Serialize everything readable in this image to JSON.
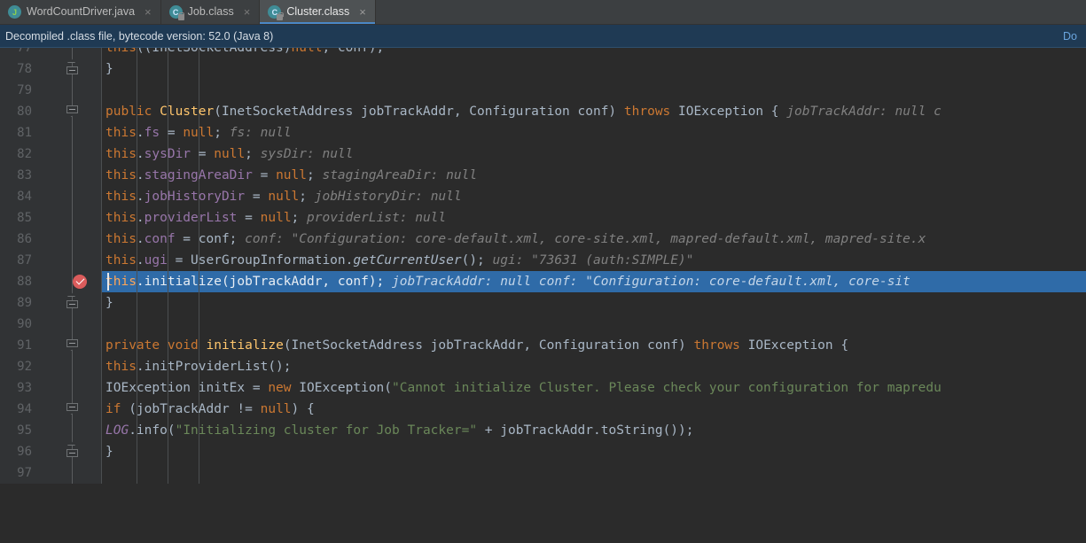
{
  "window": {
    "editor_bg": "#2b2b2b",
    "gutter_bg": "#313335",
    "tabbar_bg": "#3c3f41",
    "accent": "#4a88c7",
    "current_line_bg": "#2f6ba8",
    "breakpoint_color": "#db5c5c"
  },
  "tabs": [
    {
      "label": "WordCountDriver.java",
      "icon": "java-file-icon",
      "close": "×",
      "active": false,
      "locked": false
    },
    {
      "label": "Job.class",
      "icon": "class-file-icon",
      "close": "×",
      "active": false,
      "locked": true
    },
    {
      "label": "Cluster.class",
      "icon": "class-file-icon",
      "close": "×",
      "active": true,
      "locked": true
    }
  ],
  "notification": {
    "message": "Decompiled .class file, bytecode version: 52.0 (Java 8)",
    "action_label": "Do"
  },
  "editor": {
    "language": "Java",
    "current_line": 88,
    "breakpoint_line": 88,
    "lines": [
      {
        "number": "77",
        "clipped": true,
        "fold": null,
        "tokens": [
          {
            "t": "        ",
            "c": "plain"
          },
          {
            "t": "this",
            "c": "kw"
          },
          {
            "t": "((InetSocketAddress)",
            "c": "plain"
          },
          {
            "t": "null",
            "c": "kw"
          },
          {
            "t": ", conf);",
            "c": "plain"
          }
        ]
      },
      {
        "number": "78",
        "fold": "end",
        "tokens": [
          {
            "t": "    }",
            "c": "plain"
          }
        ]
      },
      {
        "number": "79",
        "fold": null,
        "tokens": []
      },
      {
        "number": "80",
        "fold": "start",
        "tokens": [
          {
            "t": "    ",
            "c": "plain"
          },
          {
            "t": "public ",
            "c": "kw"
          },
          {
            "t": "Cluster",
            "c": "cls"
          },
          {
            "t": "(InetSocketAddress jobTrackAddr, Configuration conf) ",
            "c": "plain"
          },
          {
            "t": "throws ",
            "c": "kw"
          },
          {
            "t": "IOException {",
            "c": "plain"
          },
          {
            "t": "   jobTrackAddr: null     c",
            "c": "hint"
          }
        ]
      },
      {
        "number": "81",
        "fold": null,
        "tokens": [
          {
            "t": "        ",
            "c": "plain"
          },
          {
            "t": "this",
            "c": "kw"
          },
          {
            "t": ".",
            "c": "plain"
          },
          {
            "t": "fs",
            "c": "fld"
          },
          {
            "t": " = ",
            "c": "plain"
          },
          {
            "t": "null",
            "c": "kw"
          },
          {
            "t": ";",
            "c": "plain"
          },
          {
            "t": "   fs: null",
            "c": "hint"
          }
        ]
      },
      {
        "number": "82",
        "fold": null,
        "tokens": [
          {
            "t": "        ",
            "c": "plain"
          },
          {
            "t": "this",
            "c": "kw"
          },
          {
            "t": ".",
            "c": "plain"
          },
          {
            "t": "sysDir",
            "c": "fld"
          },
          {
            "t": " = ",
            "c": "plain"
          },
          {
            "t": "null",
            "c": "kw"
          },
          {
            "t": ";",
            "c": "plain"
          },
          {
            "t": "   sysDir: null",
            "c": "hint"
          }
        ]
      },
      {
        "number": "83",
        "fold": null,
        "tokens": [
          {
            "t": "        ",
            "c": "plain"
          },
          {
            "t": "this",
            "c": "kw"
          },
          {
            "t": ".",
            "c": "plain"
          },
          {
            "t": "stagingAreaDir",
            "c": "fld"
          },
          {
            "t": " = ",
            "c": "plain"
          },
          {
            "t": "null",
            "c": "kw"
          },
          {
            "t": ";",
            "c": "plain"
          },
          {
            "t": "   stagingAreaDir: null",
            "c": "hint"
          }
        ]
      },
      {
        "number": "84",
        "fold": null,
        "tokens": [
          {
            "t": "        ",
            "c": "plain"
          },
          {
            "t": "this",
            "c": "kw"
          },
          {
            "t": ".",
            "c": "plain"
          },
          {
            "t": "jobHistoryDir",
            "c": "fld"
          },
          {
            "t": " = ",
            "c": "plain"
          },
          {
            "t": "null",
            "c": "kw"
          },
          {
            "t": ";",
            "c": "plain"
          },
          {
            "t": "   jobHistoryDir: null",
            "c": "hint"
          }
        ]
      },
      {
        "number": "85",
        "fold": null,
        "tokens": [
          {
            "t": "        ",
            "c": "plain"
          },
          {
            "t": "this",
            "c": "kw"
          },
          {
            "t": ".",
            "c": "plain"
          },
          {
            "t": "providerList",
            "c": "fld"
          },
          {
            "t": " = ",
            "c": "plain"
          },
          {
            "t": "null",
            "c": "kw"
          },
          {
            "t": ";",
            "c": "plain"
          },
          {
            "t": "   providerList: null",
            "c": "hint"
          }
        ]
      },
      {
        "number": "86",
        "fold": null,
        "tokens": [
          {
            "t": "        ",
            "c": "plain"
          },
          {
            "t": "this",
            "c": "kw"
          },
          {
            "t": ".",
            "c": "plain"
          },
          {
            "t": "conf",
            "c": "fld"
          },
          {
            "t": " = conf;",
            "c": "plain"
          },
          {
            "t": "   conf: \"Configuration: core-default.xml, core-site.xml, mapred-default.xml, mapred-site.x",
            "c": "hint"
          }
        ]
      },
      {
        "number": "87",
        "fold": null,
        "tokens": [
          {
            "t": "        ",
            "c": "plain"
          },
          {
            "t": "this",
            "c": "kw"
          },
          {
            "t": ".",
            "c": "plain"
          },
          {
            "t": "ugi",
            "c": "fld"
          },
          {
            "t": " = UserGroupInformation.",
            "c": "plain"
          },
          {
            "t": "getCurrentUser",
            "c": "smth"
          },
          {
            "t": "();",
            "c": "plain"
          },
          {
            "t": "   ugi: \"73631 (auth:SIMPLE)\"",
            "c": "hint"
          }
        ]
      },
      {
        "number": "88",
        "fold": null,
        "current": true,
        "breakpoint": true,
        "tokens": [
          {
            "t": "        ",
            "c": "plain"
          },
          {
            "t": "this",
            "c": "kw"
          },
          {
            "t": ".initialize(jobTrackAddr, conf);",
            "c": "plain"
          },
          {
            "t": "   jobTrackAddr: null    conf: \"Configuration: core-default.xml, core-sit",
            "c": "hint"
          }
        ]
      },
      {
        "number": "89",
        "fold": "end",
        "tokens": [
          {
            "t": "    }",
            "c": "plain"
          }
        ]
      },
      {
        "number": "90",
        "fold": null,
        "tokens": []
      },
      {
        "number": "91",
        "fold": "start",
        "tokens": [
          {
            "t": "    ",
            "c": "plain"
          },
          {
            "t": "private void ",
            "c": "kw"
          },
          {
            "t": "initialize",
            "c": "mth"
          },
          {
            "t": "(InetSocketAddress jobTrackAddr, Configuration conf) ",
            "c": "plain"
          },
          {
            "t": "throws ",
            "c": "kw"
          },
          {
            "t": "IOException {",
            "c": "plain"
          }
        ]
      },
      {
        "number": "92",
        "fold": null,
        "tokens": [
          {
            "t": "        ",
            "c": "plain"
          },
          {
            "t": "this",
            "c": "kw"
          },
          {
            "t": ".initProviderList();",
            "c": "plain"
          }
        ]
      },
      {
        "number": "93",
        "fold": null,
        "tokens": [
          {
            "t": "        IOException initEx = ",
            "c": "plain"
          },
          {
            "t": "new ",
            "c": "kw"
          },
          {
            "t": "IOException(",
            "c": "plain"
          },
          {
            "t": "\"Cannot initialize Cluster. Please check your configuration for mapredu",
            "c": "str"
          }
        ]
      },
      {
        "number": "94",
        "fold": "start",
        "tokens": [
          {
            "t": "        ",
            "c": "plain"
          },
          {
            "t": "if ",
            "c": "kw"
          },
          {
            "t": "(jobTrackAddr != ",
            "c": "plain"
          },
          {
            "t": "null",
            "c": "kw"
          },
          {
            "t": ") {",
            "c": "plain"
          }
        ]
      },
      {
        "number": "95",
        "fold": null,
        "tokens": [
          {
            "t": "            ",
            "c": "plain"
          },
          {
            "t": "LOG",
            "c": "sfld"
          },
          {
            "t": ".info(",
            "c": "plain"
          },
          {
            "t": "\"Initializing cluster for Job Tracker=\"",
            "c": "str"
          },
          {
            "t": " + jobTrackAddr.toString());",
            "c": "plain"
          }
        ]
      },
      {
        "number": "96",
        "fold": "end",
        "tokens": [
          {
            "t": "        }",
            "c": "plain"
          }
        ]
      },
      {
        "number": "97",
        "clipped": true,
        "fold": null,
        "tokens": []
      }
    ]
  }
}
